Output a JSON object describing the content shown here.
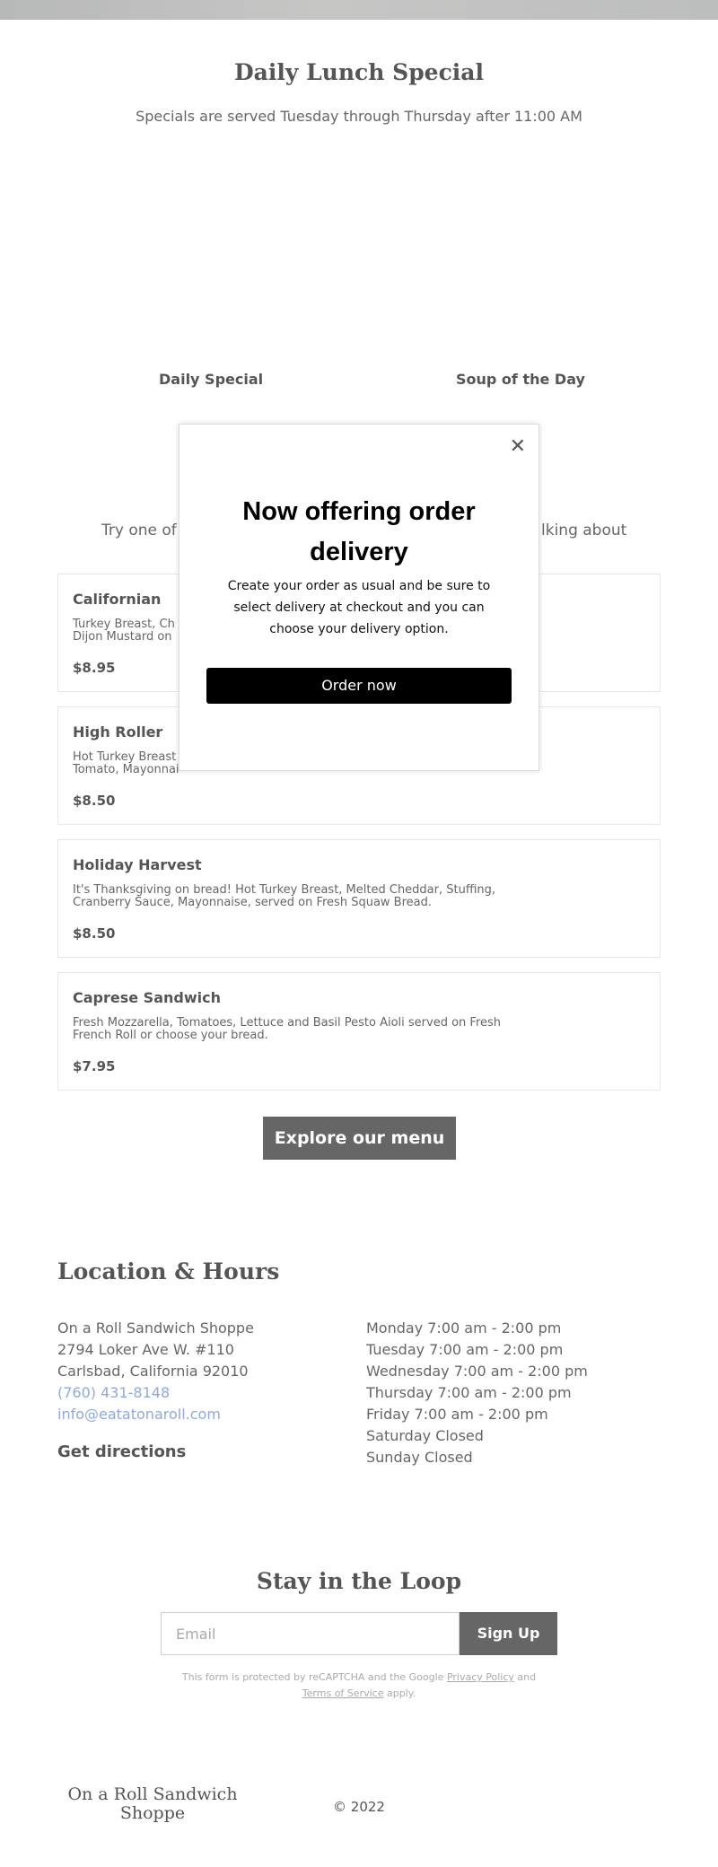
{
  "lunch": {
    "title": "Daily Lunch Special",
    "subtitle": "Specials are served Tuesday through Thursday after 11:00 AM",
    "tabs": [
      "Daily Special",
      "Soup of the Day"
    ],
    "tagline_left": "Try one of o",
    "tagline_right": "lking about"
  },
  "menu_items": [
    {
      "name": "Californian",
      "desc_line1": "Turkey Breast, Ch",
      "desc_line2": "Dijon Mustard on",
      "price": "$8.95"
    },
    {
      "name": "High Roller",
      "desc_line1": "Hot Turkey Breast",
      "desc_line2": "Tomato, Mayonnai",
      "price": "$8.50"
    },
    {
      "name": "Holiday Harvest",
      "desc_line1": "It's Thanksgiving on bread! Hot Turkey Breast, Melted Cheddar, Stuffing,",
      "desc_line2": "Cranberry Sauce, Mayonnaise, served on Fresh Squaw Bread.",
      "price": "$8.50"
    },
    {
      "name": "Caprese Sandwich",
      "desc_line1": "Fresh Mozzarella, Tomatoes, Lettuce and Basil Pesto Aioli served on Fresh",
      "desc_line2": "French Roll or choose your bread.",
      "price": "$7.95"
    }
  ],
  "explore_button": "Explore our menu",
  "location": {
    "title": "Location & Hours",
    "address": [
      "On a Roll Sandwich Shoppe",
      "2794 Loker Ave W. #110",
      "Carlsbad, California 92010"
    ],
    "phone": "(760) 431-8148",
    "email": "info@eatatonaroll.com",
    "directions": "Get directions",
    "hours": [
      "Monday 7:00 am - 2:00 pm",
      "Tuesday 7:00 am - 2:00 pm",
      "Wednesday 7:00 am - 2:00 pm",
      "Thursday 7:00 am - 2:00 pm",
      "Friday 7:00 am - 2:00 pm",
      "Saturday Closed",
      "Sunday Closed"
    ]
  },
  "newsletter": {
    "title": "Stay in the Loop",
    "email_placeholder": "Email",
    "signup_label": "Sign Up",
    "recaptcha_pre": "This form is protected by reCAPTCHA and the Google",
    "privacy": "Privacy Policy",
    "and": "and",
    "terms": "Terms of Service",
    "apply": "apply."
  },
  "footer": {
    "logo": "On a Roll Sandwich Shoppe",
    "copyright": "© 2022"
  },
  "modal": {
    "close_glyph": "✕",
    "title_line1": "Now offering order",
    "title_line2": "delivery",
    "text_line1": "Create your order as usual and be sure to",
    "text_line2": "select delivery at checkout and you can",
    "text_line3": "choose  your delivery option.",
    "button": "Order now"
  }
}
